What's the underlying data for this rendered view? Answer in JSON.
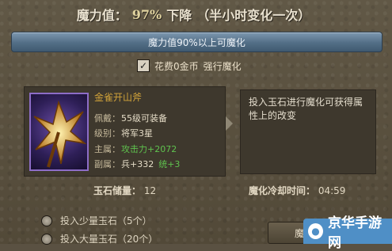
{
  "header": {
    "label": "魔力值：",
    "value": "97%",
    "trend": "下降",
    "note": "（半小时变化一次）"
  },
  "refine_bar": {
    "label": "魔力值90%以上可魔化"
  },
  "force_option": {
    "checked": true,
    "cost_text": "花费0金币",
    "action_text": "强行魔化"
  },
  "item": {
    "name": "金雀开山斧",
    "stats": [
      {
        "key": "佩戴：",
        "value": "55级可装备"
      },
      {
        "key": "级别：",
        "value": "将军3星"
      },
      {
        "key": "主属：",
        "value": "攻击力+2072"
      },
      {
        "key": "副属：",
        "value": "兵+332",
        "extra": "统+3"
      }
    ]
  },
  "description": "投入玉石进行魔化可获得属性上的改变",
  "jade_stock": {
    "label": "玉石储量：",
    "value": "12"
  },
  "cooldown": {
    "label": "魔化冷却时间：",
    "value": "04:59"
  },
  "options": [
    {
      "label": "投入少量玉石（5个）"
    },
    {
      "label": "投入大量玉石（20个）"
    }
  ],
  "action_button": {
    "label": "魔化"
  },
  "watermark": {
    "text": "京华手游网"
  },
  "colors": {
    "item_name": "#d1a33a",
    "stat_highlight": "#5fc24e",
    "bar": "#5f7a93"
  }
}
